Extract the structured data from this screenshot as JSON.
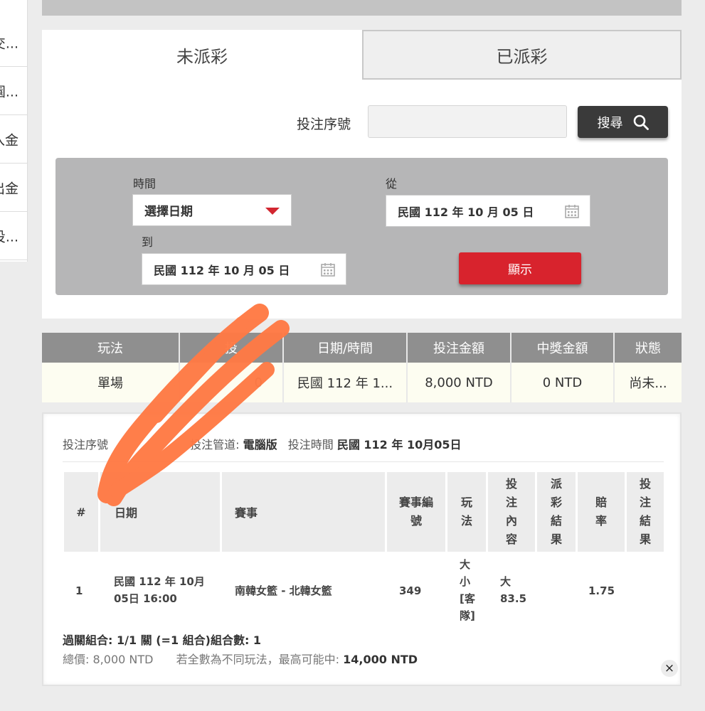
{
  "side_menu": {
    "items": [
      "交...",
      "園...",
      "入金",
      "出金",
      "投..."
    ]
  },
  "tabs": {
    "unpaid": "未派彩",
    "paid": "已派彩"
  },
  "search": {
    "serial_label": "投注序號",
    "serial_value": "",
    "button_label": "搜尋"
  },
  "filter": {
    "time_label": "時間",
    "select_value": "選擇日期",
    "from_label": "從",
    "from_value": "民國 112 年 10 月 05 日",
    "to_label": "到",
    "to_value": "民國 112 年 10 月 05 日",
    "show_button": "顯示"
  },
  "summary": {
    "headers": [
      "玩法",
      "投",
      "日期/時間",
      "投注金額",
      "中獎金額",
      "狀態"
    ],
    "row": [
      "單場",
      "0",
      "民國 112 年 1...",
      "8,000 NTD",
      "0 NTD",
      "尚未..."
    ]
  },
  "detail": {
    "serial_label": "投注序號",
    "channel_label": "投注管道:",
    "channel_value": "電腦版",
    "time_label": "投注時間",
    "time_value": "民國 112 年 10月05日",
    "headers": {
      "index": "#",
      "date": "日期",
      "event": "賽事",
      "event_no": "賽事編號",
      "play": "玩法",
      "content": "投注內容",
      "result": "派彩結果",
      "odds": "賠率",
      "bet_result": "投注結果"
    },
    "row": {
      "index": "1",
      "date": "民國 112 年 10月 05日 16:00",
      "event": "南韓女籃 - 北韓女籃",
      "event_no": "349",
      "play": "大小[客隊]",
      "content": "大 83.5",
      "result": "",
      "odds": "1.75",
      "bet_result": ""
    },
    "combo": "過關組合: 1/1 關 (=1 組合)組合數: 1",
    "total_label": "總價:",
    "total_value": "8,000 NTD",
    "max_label": "若全數為不同玩法，最高可能中:",
    "max_value": "14,000 NTD",
    "close_icon": "×"
  },
  "colors": {
    "accent_red": "#d8232d",
    "dark_button": "#3a3a3a",
    "header_gray": "#8f8f8f",
    "scribble": "#ff7a45"
  }
}
